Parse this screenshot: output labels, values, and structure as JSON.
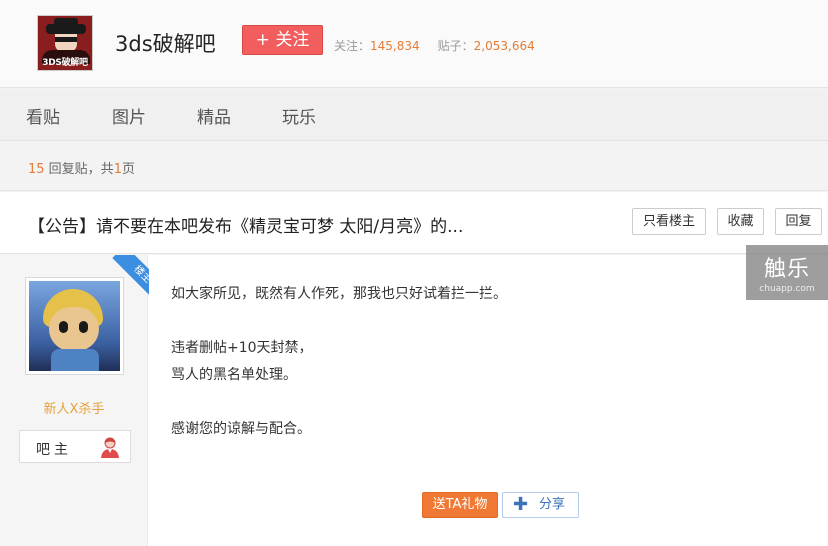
{
  "header": {
    "logo_text": "3DS破解吧",
    "forum_name": "3ds破解吧",
    "follow_label": "+ 关注",
    "follow_stat_label": "关注：",
    "follow_count": "145,834",
    "post_stat_label": "贴子：",
    "post_count": "2,053,664"
  },
  "nav": {
    "items": [
      {
        "label": "看贴"
      },
      {
        "label": "图片"
      },
      {
        "label": "精品"
      },
      {
        "label": "玩乐"
      }
    ]
  },
  "reply_bar": {
    "reply_count": "15",
    "reply_label": " 回复贴，共",
    "page_count": "1",
    "page_label": "页"
  },
  "thread": {
    "title": "【公告】请不要在本吧发布《精灵宝可梦 太阳/月亮》的...",
    "buttons": {
      "only_op": "只看楼主",
      "favorite": "收藏",
      "reply": "回复"
    }
  },
  "post": {
    "op_badge": "楼主",
    "author_name": "新人X杀手",
    "role": "吧主",
    "lines": [
      "如大家所见，既然有人作死，那我也只好试着拦一拦。",
      "",
      "违者删帖+10天封禁，",
      "骂人的黑名单处理。",
      "",
      "感谢您的谅解与配合。"
    ],
    "gift_label": "送TA礼物",
    "share_label": "分享"
  },
  "watermark": {
    "main": "触乐",
    "sub": "chuapp.com"
  },
  "colors": {
    "follow_button": "#f25d5d",
    "highlight_number": "#e67c38",
    "author_name": "#e6a23c",
    "op_ribbon": "#3b8ee0",
    "gift_button": "#f07a35",
    "share_text": "#3b73b9"
  }
}
